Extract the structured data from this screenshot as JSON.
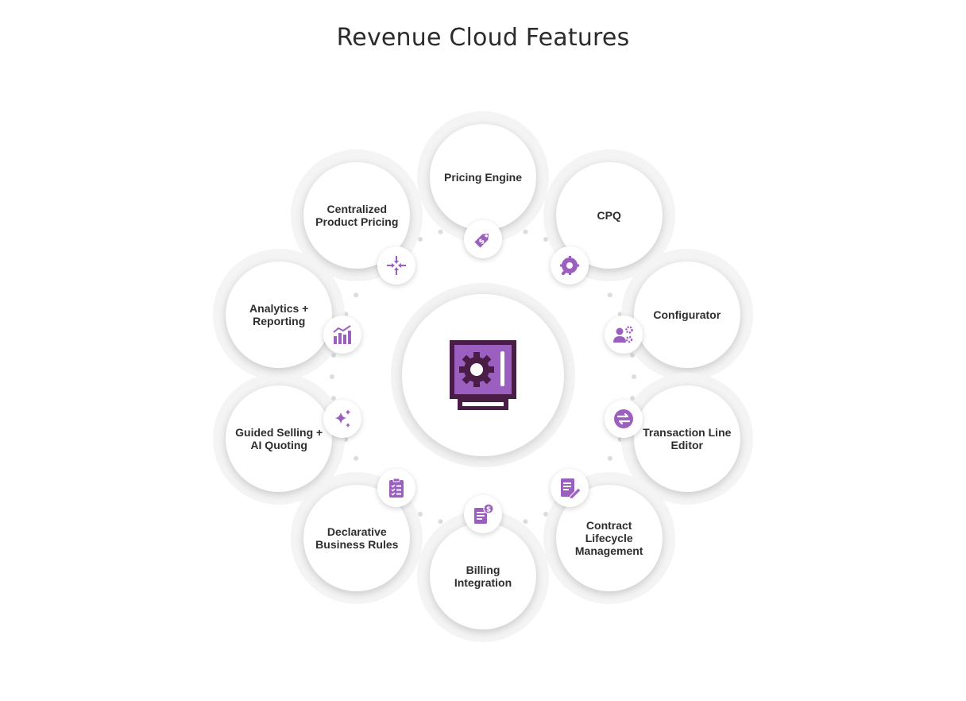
{
  "title": "Revenue Cloud Features",
  "colors": {
    "accent": "#9b5fc0",
    "dark": "#4a1d47",
    "ring_dot": "#dcdcdc"
  },
  "center_icon": "vault-gear-icon",
  "features": [
    {
      "label": "Pricing Engine",
      "icon": "price-tag-icon"
    },
    {
      "label": "CPQ",
      "icon": "wrench-gear-icon"
    },
    {
      "label": "Configurator",
      "icon": "user-gears-icon"
    },
    {
      "label": "Transaction Line\nEditor",
      "icon": "swap-arrows-icon"
    },
    {
      "label": "Contract Lifecycle\nManagement",
      "icon": "document-edit-icon"
    },
    {
      "label": "Billing\nIntegration",
      "icon": "invoice-dollar-icon"
    },
    {
      "label": "Declarative\nBusiness Rules",
      "icon": "checklist-icon"
    },
    {
      "label": "Guided Selling +\nAI Quoting",
      "icon": "sparkles-icon"
    },
    {
      "label": "Analytics +\nReporting",
      "icon": "bar-chart-trend-icon"
    },
    {
      "label": "Centralized\nProduct Pricing",
      "icon": "arrows-converge-icon"
    }
  ]
}
